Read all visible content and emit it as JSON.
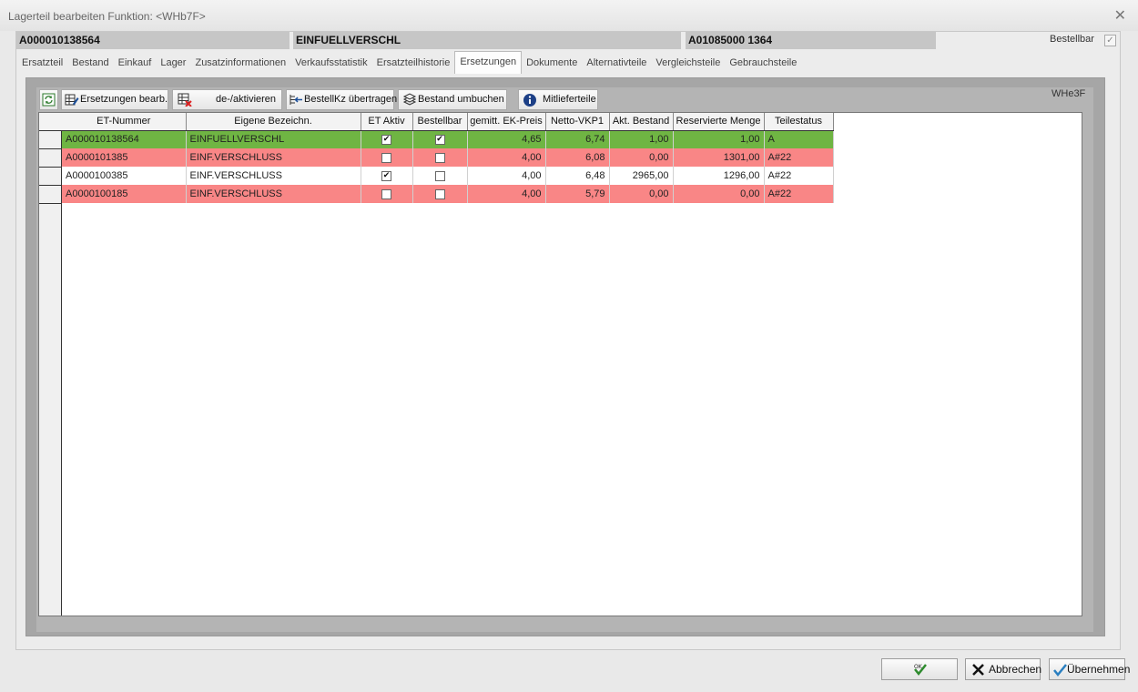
{
  "window": {
    "title": "Lagerteil bearbeiten   Funktion: <WHb7F>",
    "close_icon": "close-icon"
  },
  "infobar": {
    "part_number": "A000010138564",
    "description": "EINFUELLVERSCHL",
    "ref": "A01085000  1364",
    "bestellbar_label": "Bestellbar",
    "bestellbar_checked": true
  },
  "tabs": [
    {
      "label": "Ersatzteil"
    },
    {
      "label": "Bestand"
    },
    {
      "label": "Einkauf"
    },
    {
      "label": "Lager"
    },
    {
      "label": "Zusatzinformationen"
    },
    {
      "label": "Verkaufsstatistik"
    },
    {
      "label": "Ersatzteilhistorie"
    },
    {
      "label": "Ersetzungen",
      "active": true
    },
    {
      "label": "Dokumente"
    },
    {
      "label": "Alternativteile"
    },
    {
      "label": "Vergleichsteile"
    },
    {
      "label": "Gebrauchsteile"
    }
  ],
  "toolbar": {
    "refresh_icon": "refresh-icon",
    "edit_label": "Ersetzungen bearb.",
    "toggle_label": "de-/aktivieren",
    "transfer_label": "BestellKz übertragen",
    "rebook_label": "Bestand umbuchen",
    "suppliers_label": "Mitlieferteile",
    "code": "WHe3F"
  },
  "table": {
    "columns": [
      "ET-Nummer",
      "Eigene Bezeichn.",
      "ET Aktiv",
      "Bestellbar",
      "gemitt. EK-Preis",
      "Netto-VKP1",
      "Akt. Bestand",
      "Reservierte Menge",
      "Teilestatus"
    ],
    "rows": [
      {
        "et": "A000010138564",
        "bez": "EINFUELLVERSCHL",
        "aktiv": true,
        "bestellbar": true,
        "ek": "4,65",
        "vkp": "6,74",
        "bestand": "1,00",
        "reserviert": "1,00",
        "status": "A",
        "color": "#6fb543"
      },
      {
        "et": "A0000101385",
        "bez": "EINF.VERSCHLUSS",
        "aktiv": false,
        "bestellbar": false,
        "ek": "4,00",
        "vkp": "6,08",
        "bestand": "0,00",
        "reserviert": "1301,00",
        "status": "A#22",
        "color": "#f98686"
      },
      {
        "et": "A0000100385",
        "bez": "EINF.VERSCHLUSS",
        "aktiv": true,
        "bestellbar": false,
        "ek": "4,00",
        "vkp": "6,48",
        "bestand": "2965,00",
        "reserviert": "1296,00",
        "status": "A#22",
        "color": "#ffffff"
      },
      {
        "et": "A0000100185",
        "bez": "EINF.VERSCHLUSS",
        "aktiv": false,
        "bestellbar": false,
        "ek": "4,00",
        "vkp": "5,79",
        "bestand": "0,00",
        "reserviert": "0,00",
        "status": "A#22",
        "color": "#f98686"
      }
    ]
  },
  "footer": {
    "ok_label": "",
    "cancel_label": "Abbrechen",
    "apply_label": "Übernehmen"
  }
}
